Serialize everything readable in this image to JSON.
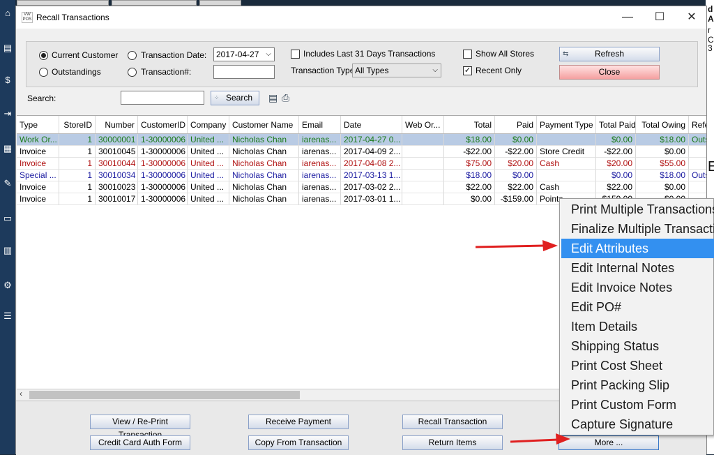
{
  "window": {
    "title": "Recall Transactions",
    "app_icon_text": "VW POS",
    "minimize": "—",
    "maximize": "☐",
    "close": "✕"
  },
  "filters": {
    "current_customer": "Current Customer",
    "outstandings": "Outstandings",
    "transaction_date_label": "Transaction Date:",
    "transaction_date_value": "2017-04-27",
    "transaction_no_label": "Transaction#:",
    "includes_31_days": "Includes Last 31 Days Transactions",
    "transaction_type_label": "Transaction Type:",
    "transaction_type_value": "All Types",
    "show_all_stores": "Show All Stores",
    "recent_only": "Recent Only",
    "refresh": "Refresh",
    "close": "Close",
    "search_label": "Search:",
    "search_button": "Search"
  },
  "grid": {
    "columns": [
      "Type",
      "StoreID",
      "Number",
      "CustomerID",
      "Company",
      "Customer Name",
      "Email",
      "Date",
      "Web Or...",
      "Total",
      "Paid",
      "Payment Type",
      "Total Paid",
      "Total Owing",
      "Refe"
    ],
    "rows": [
      [
        "Work Or...",
        "1",
        "30000001",
        "1-30000006",
        "United ...",
        "Nicholas Chan",
        "iarenas...",
        "2017-04-27 0...",
        "",
        "$18.00",
        "$0.00",
        "",
        "$0.00",
        "$18.00",
        "Outs"
      ],
      [
        "Invoice",
        "1",
        "30010045",
        "1-30000006",
        "United ...",
        "Nicholas Chan",
        "iarenas...",
        "2017-04-09 2...",
        "",
        "-$22.00",
        "-$22.00",
        "Store Credit",
        "-$22.00",
        "$0.00",
        ""
      ],
      [
        "Invoice",
        "1",
        "30010044",
        "1-30000006",
        "United ...",
        "Nicholas Chan",
        "iarenas...",
        "2017-04-08 2...",
        "",
        "$75.00",
        "$20.00",
        "Cash",
        "$20.00",
        "$55.00",
        ""
      ],
      [
        "Special ...",
        "1",
        "30010034",
        "1-30000006",
        "United ...",
        "Nicholas Chan",
        "iarenas...",
        "2017-03-13 1...",
        "",
        "$18.00",
        "$0.00",
        "",
        "$0.00",
        "$18.00",
        "Outs"
      ],
      [
        "Invoice",
        "1",
        "30010023",
        "1-30000006",
        "United ...",
        "Nicholas Chan",
        "iarenas...",
        "2017-03-02 2...",
        "",
        "$22.00",
        "$22.00",
        "Cash",
        "$22.00",
        "$0.00",
        ""
      ],
      [
        "Invoice",
        "1",
        "30010017",
        "1-30000006",
        "United ...",
        "Nicholas Chan",
        "iarenas...",
        "2017-03-01 1...",
        "",
        "$0.00",
        "-$159.00",
        "Points",
        "$159.00",
        "$0.00",
        ""
      ]
    ],
    "row_colors": [
      "#1a7a1a",
      "#000000",
      "#b01010",
      "#1a1aa0",
      "#000000",
      "#000000"
    ]
  },
  "buttons": {
    "view_reprint": "View / Re-Print Transaction",
    "receive_payment": "Receive Payment",
    "recall_transaction": "Recall Transaction",
    "credit_card_auth": "Credit Card Auth Form",
    "copy_from_transaction": "Copy From Transaction",
    "return_items": "Return Items",
    "more": "More ..."
  },
  "context_menu": {
    "items": [
      "Print Multiple Transactions",
      "Finalize Multiple Transactions",
      "Edit Attributes",
      "Edit Internal Notes",
      "Edit Invoice Notes",
      "Edit PO#",
      "Item Details",
      "Shipping Status",
      "Print Cost Sheet",
      "Print Packing Slip",
      "Print Custom Form",
      "Capture Signature"
    ],
    "selected": "Edit Attributes"
  },
  "background": {
    "right_texts": [
      "d",
      "A",
      "r C",
      "3"
    ],
    "right_letter_e": "E"
  },
  "colors": {
    "accent": "#3390f0",
    "annotation": "#e02020",
    "selected_row": "#b9cbe4"
  }
}
